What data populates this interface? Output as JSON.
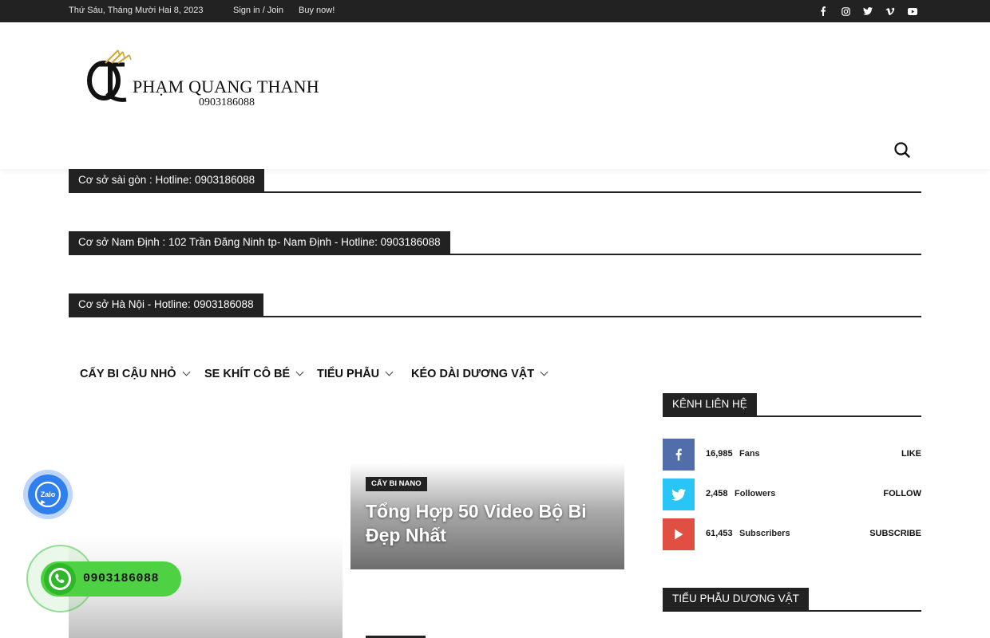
{
  "topbar": {
    "date": "Thứ Sáu, Tháng Mười Hai 8, 2023",
    "signin": "Sign in / Join",
    "buy": "Buy now!",
    "social_icons": [
      "facebook-icon",
      "instagram-icon",
      "twitter-icon",
      "vimeo-icon",
      "youtube-icon"
    ]
  },
  "logo": {
    "name": "PHẠM QUANG THANH",
    "phone": "0903186088",
    "accent": "#d4a640"
  },
  "locations": [
    {
      "label": "Cơ sở sài gòn : Hotline: 0903186088"
    },
    {
      "label": "Cơ sở Nam Định : 102 Trần Đăng Ninh tp- Nam Định - Hotline: 0903186088"
    },
    {
      "label": "Cơ sở Hà Nội - Hotline: 0903186088"
    }
  ],
  "menu": {
    "items": [
      {
        "label": "CẤY BI CẬU NHỎ"
      },
      {
        "label": "SE KHÍT CÔ BÉ"
      },
      {
        "label": "TIỂU PHẪU"
      },
      {
        "label": "KÉO DÀI DƯƠNG VẬT"
      }
    ]
  },
  "featured": {
    "category": "CẤY BI NANO",
    "title": "Tổng Hợp 50 Video Bộ Bi Đẹp Nhất"
  },
  "sidebar": {
    "contact_title": "KÊNH LIÊN HỆ",
    "social": [
      {
        "count": "16,985",
        "unit": "Fans",
        "action": "LIKE",
        "color": "#516eab",
        "icon": "facebook-icon"
      },
      {
        "count": "2,458",
        "unit": "Followers",
        "action": "FOLLOW",
        "color": "#29c5f6",
        "icon": "twitter-icon"
      },
      {
        "count": "61,453",
        "unit": "Subscribers",
        "action": "SUBSCRIBE",
        "color": "#e14e42",
        "icon": "youtube-icon"
      }
    ],
    "section2_title": "TIỂU PHẪU DƯƠNG VẬT"
  },
  "floating": {
    "zalo_label": "Zalo",
    "phone": "0903186088"
  }
}
